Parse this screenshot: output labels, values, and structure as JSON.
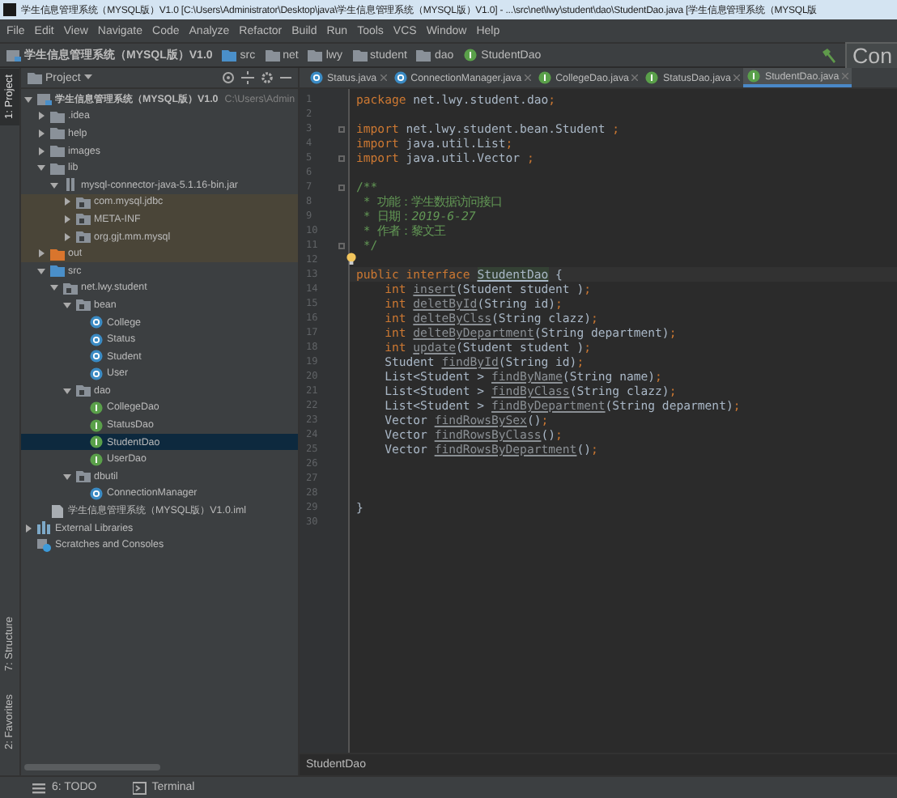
{
  "window": {
    "title": "学生信息管理系统（MYSQL版）V1.0 [C:\\Users\\Administrator\\Desktop\\java\\学生信息管理系统（MYSQL版）V1.0] - ...\\src\\net\\lwy\\student\\dao\\StudentDao.java [学生信息管理系统（MYSQL版"
  },
  "menu": [
    "File",
    "Edit",
    "View",
    "Navigate",
    "Code",
    "Analyze",
    "Refactor",
    "Build",
    "Run",
    "Tools",
    "VCS",
    "Window",
    "Help"
  ],
  "nav_bar": {
    "crumbs": [
      {
        "label": "学生信息管理系统（MYSQL版）V1.0",
        "kind": "project"
      },
      {
        "label": "src",
        "kind": "source"
      },
      {
        "label": "net",
        "kind": "package"
      },
      {
        "label": "lwy",
        "kind": "package"
      },
      {
        "label": "student",
        "kind": "package"
      },
      {
        "label": "dao",
        "kind": "package"
      },
      {
        "label": "StudentDao",
        "kind": "interface"
      }
    ],
    "run_config": "Con"
  },
  "tool_strip": {
    "top": [
      {
        "label": "1: Project",
        "selected": true
      }
    ],
    "bottom": [
      {
        "label": "7: Structure",
        "selected": false
      },
      {
        "label": "2: Favorites",
        "selected": false
      }
    ]
  },
  "project_panel": {
    "title": "Project",
    "tree": [
      {
        "label": "学生信息管理系统（MYSQL版）V1.0",
        "path": "C:\\Users\\Admin",
        "kind": "module",
        "expanded": true,
        "selected": false,
        "children": [
          {
            "label": ".idea",
            "kind": "folder",
            "expanded": false,
            "selected": false
          },
          {
            "label": "help",
            "kind": "folder",
            "expanded": false,
            "selected": false
          },
          {
            "label": "images",
            "kind": "folder",
            "expanded": false,
            "selected": false
          },
          {
            "label": "lib",
            "kind": "folder",
            "expanded": true,
            "selected": false,
            "children": [
              {
                "label": "mysql-connector-java-5.1.16-bin.jar",
                "kind": "jar",
                "expanded": true,
                "selected": false,
                "children": [
                  {
                    "label": "com.mysql.jdbc",
                    "kind": "package",
                    "expanded": false,
                    "selected": false,
                    "tinted": true
                  },
                  {
                    "label": "META-INF",
                    "kind": "package",
                    "expanded": false,
                    "selected": false,
                    "tinted": true
                  },
                  {
                    "label": "org.gjt.mm.mysql",
                    "kind": "package",
                    "expanded": false,
                    "selected": false,
                    "tinted": true
                  }
                ]
              }
            ]
          },
          {
            "label": "out",
            "kind": "excluded",
            "expanded": false,
            "selected": false,
            "tinted": true
          },
          {
            "label": "src",
            "kind": "source",
            "expanded": true,
            "selected": false,
            "children": [
              {
                "label": "net.lwy.student",
                "kind": "package",
                "expanded": true,
                "selected": false,
                "children": [
                  {
                    "label": "bean",
                    "kind": "package",
                    "expanded": true,
                    "selected": false,
                    "children": [
                      {
                        "label": "College",
                        "kind": "class",
                        "selected": false
                      },
                      {
                        "label": "Status",
                        "kind": "class",
                        "selected": false
                      },
                      {
                        "label": "Student",
                        "kind": "class",
                        "selected": false
                      },
                      {
                        "label": "User",
                        "kind": "class",
                        "selected": false
                      }
                    ]
                  },
                  {
                    "label": "dao",
                    "kind": "package",
                    "expanded": true,
                    "selected": false,
                    "children": [
                      {
                        "label": "CollegeDao",
                        "kind": "interface",
                        "selected": false
                      },
                      {
                        "label": "StatusDao",
                        "kind": "interface",
                        "selected": false
                      },
                      {
                        "label": "StudentDao",
                        "kind": "interface",
                        "selected": true
                      },
                      {
                        "label": "UserDao",
                        "kind": "interface",
                        "selected": false
                      }
                    ]
                  },
                  {
                    "label": "dbutil",
                    "kind": "package",
                    "expanded": true,
                    "selected": false,
                    "children": [
                      {
                        "label": "ConnectionManager",
                        "kind": "class",
                        "selected": false
                      }
                    ]
                  }
                ]
              }
            ]
          },
          {
            "label": "学生信息管理系统（MYSQL版）V1.0.iml",
            "kind": "iml",
            "selected": false
          }
        ]
      },
      {
        "label": "External Libraries",
        "kind": "libraries",
        "expanded": false,
        "selected": false
      },
      {
        "label": "Scratches and Consoles",
        "kind": "scratches",
        "selected": false
      }
    ]
  },
  "tabs": [
    {
      "label": "Status.java",
      "kind": "class",
      "selected": false
    },
    {
      "label": "ConnectionManager.java",
      "kind": "class",
      "selected": false
    },
    {
      "label": "CollegeDao.java",
      "kind": "interface",
      "selected": false
    },
    {
      "label": "StatusDao.java",
      "kind": "interface",
      "selected": false
    },
    {
      "label": "StudentDao.java",
      "kind": "interface",
      "selected": true
    }
  ],
  "editor": {
    "lines": [
      {
        "number": "1",
        "tokens": [
          {
            "kind": "kw",
            "text": "package"
          },
          {
            "kind": "txt",
            "text": " net.lwy.student.dao"
          },
          {
            "kind": "punct",
            "text": ";"
          }
        ]
      },
      {
        "number": "2"
      },
      {
        "number": "3",
        "fold": true,
        "tokens": [
          {
            "kind": "kw",
            "text": "import"
          },
          {
            "kind": "txt",
            "text": " net.lwy.student.bean.Student "
          },
          {
            "kind": "punct",
            "text": ";"
          }
        ]
      },
      {
        "number": "4",
        "tokens": [
          {
            "kind": "kw",
            "text": "import"
          },
          {
            "kind": "txt",
            "text": " java.util.List"
          },
          {
            "kind": "punct",
            "text": ";"
          }
        ]
      },
      {
        "number": "5",
        "fold": true,
        "tokens": [
          {
            "kind": "kw",
            "text": "import"
          },
          {
            "kind": "txt",
            "text": " java.util.Vector "
          },
          {
            "kind": "punct",
            "text": ";"
          }
        ]
      },
      {
        "number": "6"
      },
      {
        "number": "7",
        "fold": true,
        "tokens": [
          {
            "kind": "doc",
            "text": "/**"
          }
        ]
      },
      {
        "number": "8",
        "tokens": [
          {
            "kind": "doc",
            "text": " * 功能：学生数据访问接口"
          }
        ]
      },
      {
        "number": "9",
        "tokens": [
          {
            "kind": "doc",
            "text": " * 日期："
          },
          {
            "kind": "doc_italic",
            "text": "2019-6-27"
          }
        ]
      },
      {
        "number": "10",
        "tokens": [
          {
            "kind": "doc",
            "text": " * 作者：黎文王"
          }
        ]
      },
      {
        "number": "11",
        "fold": true,
        "tokens": [
          {
            "kind": "doc",
            "text": " */"
          }
        ]
      },
      {
        "number": "12",
        "bulb": true
      },
      {
        "number": "13",
        "current": true,
        "tokens": [
          {
            "kind": "kw",
            "text": "public interface "
          },
          {
            "kind": "hl",
            "text": "StudentDao"
          },
          {
            "kind": "txt",
            "text": " {"
          }
        ]
      },
      {
        "number": "14",
        "tokens": [
          {
            "kind": "kw",
            "text": "    int "
          },
          {
            "kind": "unused",
            "text": "insert"
          },
          {
            "kind": "txt",
            "text": "(Student student )"
          },
          {
            "kind": "punct",
            "text": ";"
          }
        ]
      },
      {
        "number": "15",
        "tokens": [
          {
            "kind": "kw",
            "text": "    int "
          },
          {
            "kind": "unused",
            "text": "deletById"
          },
          {
            "kind": "txt",
            "text": "(String id)"
          },
          {
            "kind": "punct",
            "text": ";"
          }
        ]
      },
      {
        "number": "16",
        "tokens": [
          {
            "kind": "kw",
            "text": "    int "
          },
          {
            "kind": "unused",
            "text": "delteByClss"
          },
          {
            "kind": "txt",
            "text": "(String clazz)"
          },
          {
            "kind": "punct",
            "text": ";"
          }
        ]
      },
      {
        "number": "17",
        "tokens": [
          {
            "kind": "kw",
            "text": "    int "
          },
          {
            "kind": "unused",
            "text": "delteByDepartment"
          },
          {
            "kind": "txt",
            "text": "(String department)"
          },
          {
            "kind": "punct",
            "text": ";"
          }
        ]
      },
      {
        "number": "18",
        "tokens": [
          {
            "kind": "kw",
            "text": "    int "
          },
          {
            "kind": "unused",
            "text": "update"
          },
          {
            "kind": "txt",
            "text": "(Student student )"
          },
          {
            "kind": "punct",
            "text": ";"
          }
        ]
      },
      {
        "number": "19",
        "tokens": [
          {
            "kind": "txt",
            "text": "    Student "
          },
          {
            "kind": "unused",
            "text": "findById"
          },
          {
            "kind": "txt",
            "text": "(String id)"
          },
          {
            "kind": "punct",
            "text": ";"
          }
        ]
      },
      {
        "number": "20",
        "tokens": [
          {
            "kind": "txt",
            "text": "    List<Student > "
          },
          {
            "kind": "unused",
            "text": "findByName"
          },
          {
            "kind": "txt",
            "text": "(String name)"
          },
          {
            "kind": "punct",
            "text": ";"
          }
        ]
      },
      {
        "number": "21",
        "tokens": [
          {
            "kind": "txt",
            "text": "    List<Student > "
          },
          {
            "kind": "unused",
            "text": "findByClass"
          },
          {
            "kind": "txt",
            "text": "(String clazz)"
          },
          {
            "kind": "punct",
            "text": ";"
          }
        ]
      },
      {
        "number": "22",
        "tokens": [
          {
            "kind": "txt",
            "text": "    List<Student > "
          },
          {
            "kind": "unused",
            "text": "findByDepartment"
          },
          {
            "kind": "txt",
            "text": "(String deparment)"
          },
          {
            "kind": "punct",
            "text": ";"
          }
        ]
      },
      {
        "number": "23",
        "tokens": [
          {
            "kind": "txt",
            "text": "    Vector "
          },
          {
            "kind": "unused",
            "text": "findRowsBySex"
          },
          {
            "kind": "txt",
            "text": "()"
          },
          {
            "kind": "punct",
            "text": ";"
          }
        ]
      },
      {
        "number": "24",
        "tokens": [
          {
            "kind": "txt",
            "text": "    Vector "
          },
          {
            "kind": "unused",
            "text": "findRowsByClass"
          },
          {
            "kind": "txt",
            "text": "()"
          },
          {
            "kind": "punct",
            "text": ";"
          }
        ]
      },
      {
        "number": "25",
        "tokens": [
          {
            "kind": "txt",
            "text": "    Vector "
          },
          {
            "kind": "unused",
            "text": "findRowsByDepartment"
          },
          {
            "kind": "txt",
            "text": "()"
          },
          {
            "kind": "punct",
            "text": ";"
          }
        ]
      },
      {
        "number": "26"
      },
      {
        "number": "27"
      },
      {
        "number": "28"
      },
      {
        "number": "29",
        "tokens": [
          {
            "kind": "txt",
            "text": "}"
          }
        ]
      },
      {
        "number": "30"
      }
    ]
  },
  "breadcrumb": "StudentDao",
  "status_bar": [
    {
      "label": "6: TODO",
      "kind": "todo"
    },
    {
      "label": "Terminal",
      "kind": "terminal"
    }
  ]
}
